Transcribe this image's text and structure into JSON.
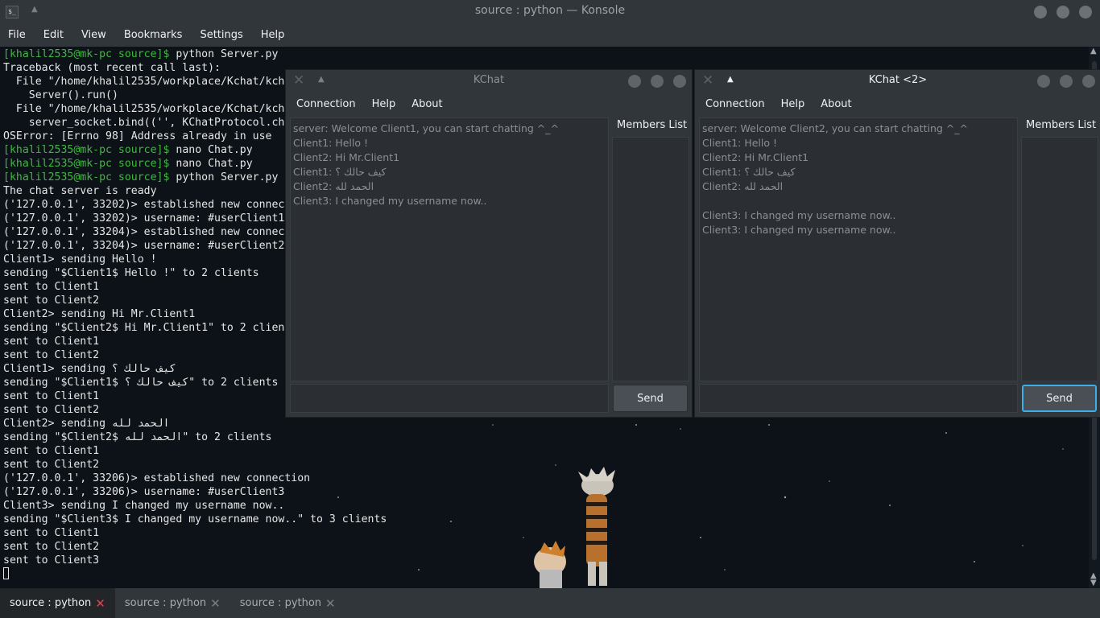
{
  "konsole": {
    "title": "source : python — Konsole",
    "app_icon_label": "$_",
    "menu": [
      "File",
      "Edit",
      "View",
      "Bookmarks",
      "Settings",
      "Help"
    ]
  },
  "terminal": {
    "lines": [
      {
        "prompt": "[khalil2535@mk-pc source]$",
        "text": " python Server.py"
      },
      {
        "prompt": "",
        "text": "Traceback (most recent call last):"
      },
      {
        "prompt": "",
        "text": "  File \"/home/khalil2535/workplace/Kchat/kch"
      },
      {
        "prompt": "",
        "text": "    Server().run()"
      },
      {
        "prompt": "",
        "text": "  File \"/home/khalil2535/workplace/Kchat/kch"
      },
      {
        "prompt": "",
        "text": "    server_socket.bind(('', KChatProtocol.ch"
      },
      {
        "prompt": "",
        "text": "OSError: [Errno 98] Address already in use"
      },
      {
        "prompt": "[khalil2535@mk-pc source]$",
        "text": " nano Chat.py"
      },
      {
        "prompt": "[khalil2535@mk-pc source]$",
        "text": " nano Chat.py"
      },
      {
        "prompt": "[khalil2535@mk-pc source]$",
        "text": " python Server.py"
      },
      {
        "prompt": "",
        "text": "The chat server is ready"
      },
      {
        "prompt": "",
        "text": "('127.0.0.1', 33202)> established new connec"
      },
      {
        "prompt": "",
        "text": "('127.0.0.1', 33202)> username: #userClient1"
      },
      {
        "prompt": "",
        "text": "('127.0.0.1', 33204)> established new connec"
      },
      {
        "prompt": "",
        "text": "('127.0.0.1', 33204)> username: #userClient2"
      },
      {
        "prompt": "",
        "text": "Client1> sending Hello !"
      },
      {
        "prompt": "",
        "text": "sending \"$Client1$ Hello !\" to 2 clients"
      },
      {
        "prompt": "",
        "text": "sent to Client1"
      },
      {
        "prompt": "",
        "text": "sent to Client2"
      },
      {
        "prompt": "",
        "text": "Client2> sending Hi Mr.Client1"
      },
      {
        "prompt": "",
        "text": "sending \"$Client2$ Hi Mr.Client1\" to 2 clien"
      },
      {
        "prompt": "",
        "text": "sent to Client1"
      },
      {
        "prompt": "",
        "text": "sent to Client2"
      },
      {
        "prompt": "",
        "text": "Client1> sending كيف حالك ؟"
      },
      {
        "prompt": "",
        "text": "sending \"$Client1$ كيف حالك ؟\" to 2 clients"
      },
      {
        "prompt": "",
        "text": "sent to Client1"
      },
      {
        "prompt": "",
        "text": "sent to Client2"
      },
      {
        "prompt": "",
        "text": "Client2> sending الحمد لله"
      },
      {
        "prompt": "",
        "text": "sending \"$Client2$ الحمد لله\" to 2 clients"
      },
      {
        "prompt": "",
        "text": "sent to Client1"
      },
      {
        "prompt": "",
        "text": "sent to Client2"
      },
      {
        "prompt": "",
        "text": "('127.0.0.1', 33206)> established new connection"
      },
      {
        "prompt": "",
        "text": "('127.0.0.1', 33206)> username: #userClient3"
      },
      {
        "prompt": "",
        "text": "Client3> sending I changed my username now.."
      },
      {
        "prompt": "",
        "text": "sending \"$Client3$ I changed my username now..\" to 3 clients"
      },
      {
        "prompt": "",
        "text": "sent to Client1"
      },
      {
        "prompt": "",
        "text": "sent to Client2"
      },
      {
        "prompt": "",
        "text": "sent to Client3"
      }
    ]
  },
  "tabs": [
    {
      "label": "source : python",
      "active": true
    },
    {
      "label": "source : python",
      "active": false
    },
    {
      "label": "source : python",
      "active": false
    }
  ],
  "kchat1": {
    "title": "KChat",
    "menu": [
      "Connection",
      "Help",
      "About"
    ],
    "members_header": "Members List",
    "send_label": "Send",
    "messages": [
      "server: Welcome Client1, you can start chatting  ^_^",
      "Client1: Hello !",
      "Client2: Hi Mr.Client1",
      "Client1: كيف حالك ؟",
      "Client2: الحمد لله",
      "Client3: I changed my username now.."
    ]
  },
  "kchat2": {
    "title": "KChat <2>",
    "menu": [
      "Connection",
      "Help",
      "About"
    ],
    "members_header": "Members List",
    "send_label": "Send",
    "messages": [
      "server: Welcome Client2, you can start chatting  ^_^",
      "Client1: Hello !",
      "Client2: Hi Mr.Client1",
      "Client1: كيف حالك ؟",
      "Client2: الحمد لله",
      "",
      "Client3: I changed my username now..",
      "Client3: I changed my username now.."
    ]
  },
  "colors": {
    "prompt_green": "#3fb83f",
    "active_tab_close": "#da4453",
    "focus_blue": "#3daee9"
  }
}
